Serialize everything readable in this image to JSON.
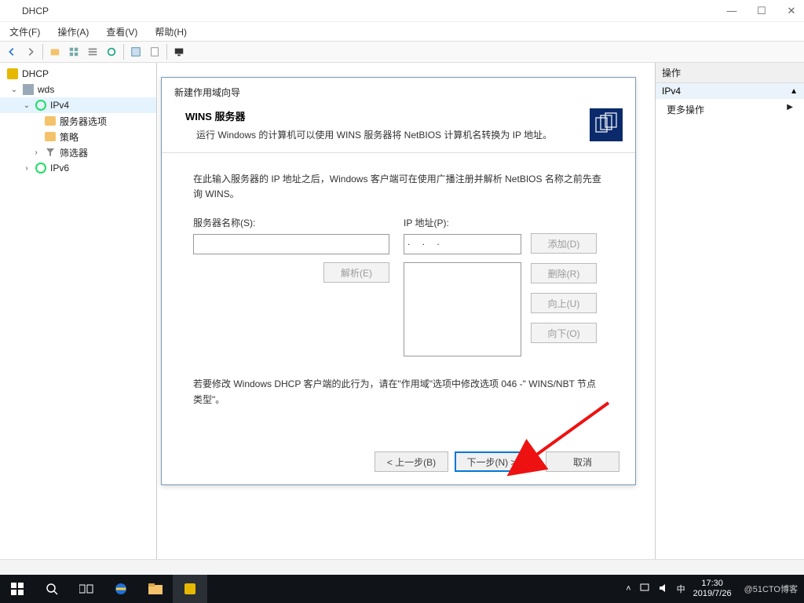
{
  "app": {
    "title": "DHCP"
  },
  "menu": {
    "file": "文件(F)",
    "action": "操作(A)",
    "view": "查看(V)",
    "help": "帮助(H)"
  },
  "tree": {
    "root": "DHCP",
    "server": "wds",
    "ipv4": "IPv4",
    "server_options": "服务器选项",
    "policy": "策略",
    "filter": "筛选器",
    "ipv6": "IPv6"
  },
  "actions": {
    "header": "操作",
    "section": "IPv4",
    "more": "更多操作"
  },
  "wizard": {
    "title": "新建作用域向导",
    "heading": "WINS 服务器",
    "subheading": "运行 Windows 的计算机可以使用 WINS 服务器将 NetBIOS 计算机名转换为 IP 地址。",
    "desc": "在此输入服务器的 IP 地址之后，Windows 客户端可在使用广播注册并解析 NetBIOS 名称之前先查询 WINS。",
    "server_name_label": "服务器名称(S):",
    "ip_label": "IP 地址(P):",
    "ip_value": "      .       .       .",
    "resolve_btn": "解析(E)",
    "add_btn": "添加(D)",
    "remove_btn": "删除(R)",
    "up_btn": "向上(U)",
    "down_btn": "向下(O)",
    "note": "若要修改 Windows DHCP 客户端的此行为，请在\"作用域\"选项中修改选项 046 -\" WINS/NBT 节点类型\"。",
    "back": "< 上一步(B)",
    "next": "下一步(N) >",
    "cancel": "取消"
  },
  "tray": {
    "time": "17:30",
    "date": "2019/7/26",
    "watermark": "@51CTO博客",
    "ime": "中"
  }
}
